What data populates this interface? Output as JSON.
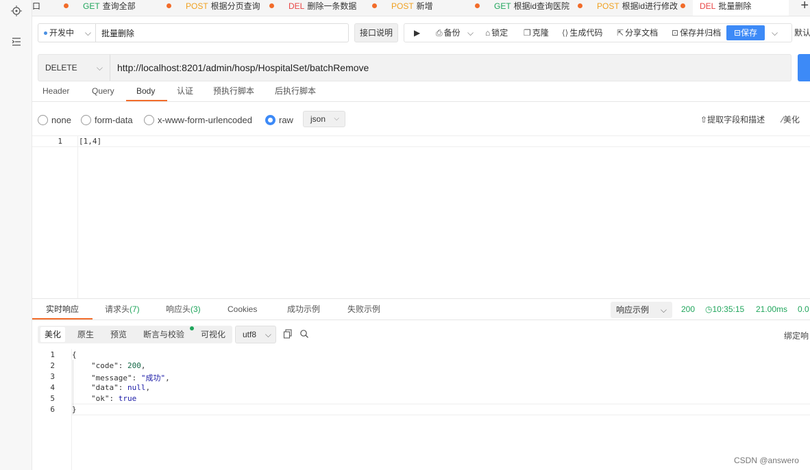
{
  "tabs": [
    {
      "method": "",
      "name": "口"
    },
    {
      "method": "GET",
      "name": "查询全部"
    },
    {
      "method": "POST",
      "name": "根据分页查询"
    },
    {
      "method": "DEL",
      "name": "删除一条数据"
    },
    {
      "method": "POST",
      "name": "新增"
    },
    {
      "method": "GET",
      "name": "根据id查询医院"
    },
    {
      "method": "POST",
      "name": "根据id进行修改"
    },
    {
      "method": "DEL",
      "name": "批量删除"
    }
  ],
  "toolbar": {
    "status": "开发中",
    "api_name": "批量删除",
    "doc_label": "接口说明",
    "backup": "备份",
    "lock": "锁定",
    "clone": "克隆",
    "gen_code": "生成代码",
    "share": "分享文档",
    "save_archive": "保存并归档",
    "save": "保存",
    "default_env": "默认"
  },
  "request": {
    "method": "DELETE",
    "url": "http://localhost:8201/admin/hosp/HospitalSet/batchRemove"
  },
  "request_tabs": [
    "Header",
    "Query",
    "Body",
    "认证",
    "预执行脚本",
    "后执行脚本"
  ],
  "body_options": {
    "none": "none",
    "form_data": "form-data",
    "urlencoded": "x-www-form-urlencoded",
    "raw": "raw",
    "format": "json",
    "extract": "提取字段和描述",
    "beautify": "美化"
  },
  "body_editor": {
    "line1_no": "1",
    "line1": "[1,4]"
  },
  "response_tabs": {
    "realtime": "实时响应",
    "req_headers": "请求头",
    "req_headers_count": "(7)",
    "resp_headers": "响应头",
    "resp_headers_count": "(3)",
    "cookies": "Cookies",
    "success_example": "成功示例",
    "fail_example": "失败示例"
  },
  "response_meta": {
    "example_sel": "响应示例",
    "status": "200",
    "time": "10:35:15",
    "duration": "21.00ms",
    "size": "0.0"
  },
  "response_toolbar": {
    "beautify": "美化",
    "raw": "原生",
    "preview": "预览",
    "assert": "断言与校验",
    "visualize": "可视化",
    "encoding": "utf8",
    "bind": "绑定响"
  },
  "response_lines": {
    "l1": "{",
    "code_key": "\"code\"",
    "code_val": "200",
    "msg_key": "\"message\"",
    "msg_val": "\"成功\"",
    "data_key": "\"data\"",
    "data_val": "null",
    "ok_key": "\"ok\"",
    "ok_val": "true",
    "l6": "}"
  },
  "watermark": "CSDN @answero",
  "colors": {
    "accent": "#3d8af7",
    "tab_underline": "#f26c2a",
    "success": "#1fa55b"
  }
}
